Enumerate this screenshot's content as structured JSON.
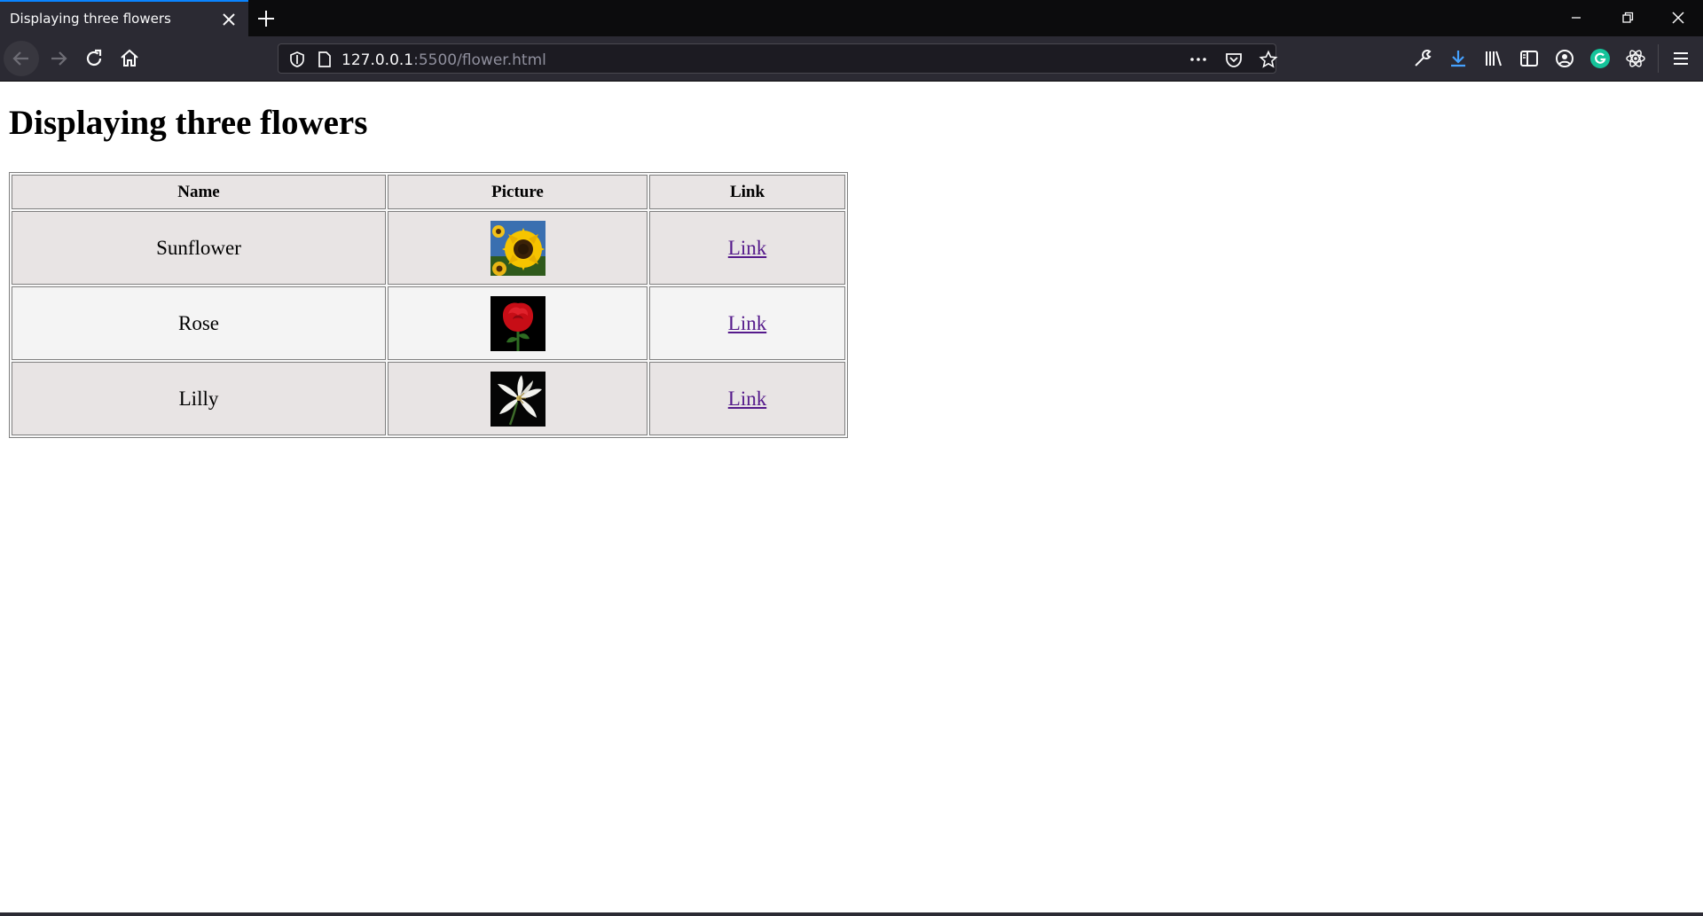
{
  "browser": {
    "tab": {
      "title": "Displaying three flowers"
    },
    "url": {
      "host": "127.0.0.1",
      "path": ":5500/flower.html"
    }
  },
  "icons": {
    "tab_close": "close-icon",
    "new_tab": "plus-icon",
    "minimize": "minimize-icon",
    "restore": "restore-icon",
    "close_window": "close-icon",
    "back": "back-arrow-icon",
    "forward": "forward-arrow-icon",
    "reload": "reload-icon",
    "home": "home-icon",
    "shield": "shield-icon",
    "page": "page-icon",
    "more": "more-icon",
    "pocket": "pocket-icon",
    "bookmark": "star-icon",
    "wrench": "wrench-icon",
    "download": "download-icon",
    "library": "library-icon",
    "sidebar": "sidebar-icon",
    "account": "account-icon",
    "grammarly": "grammarly-icon",
    "react": "react-icon",
    "menu": "hamburger-menu-icon"
  },
  "colors": {
    "tab_accent": "#0a84ff",
    "download_accent": "#45a1ff",
    "grammarly": "#15c39a",
    "link_visited": "#551a8b"
  },
  "page": {
    "heading": "Displaying three flowers",
    "table": {
      "headers": [
        "Name",
        "Picture",
        "Link"
      ],
      "rows": [
        {
          "name": "Sunflower",
          "picture": "sunflower-image",
          "link": "Link"
        },
        {
          "name": "Rose",
          "picture": "rose-image",
          "link": "Link"
        },
        {
          "name": "Lilly",
          "picture": "lily-image",
          "link": "Link"
        }
      ]
    }
  }
}
